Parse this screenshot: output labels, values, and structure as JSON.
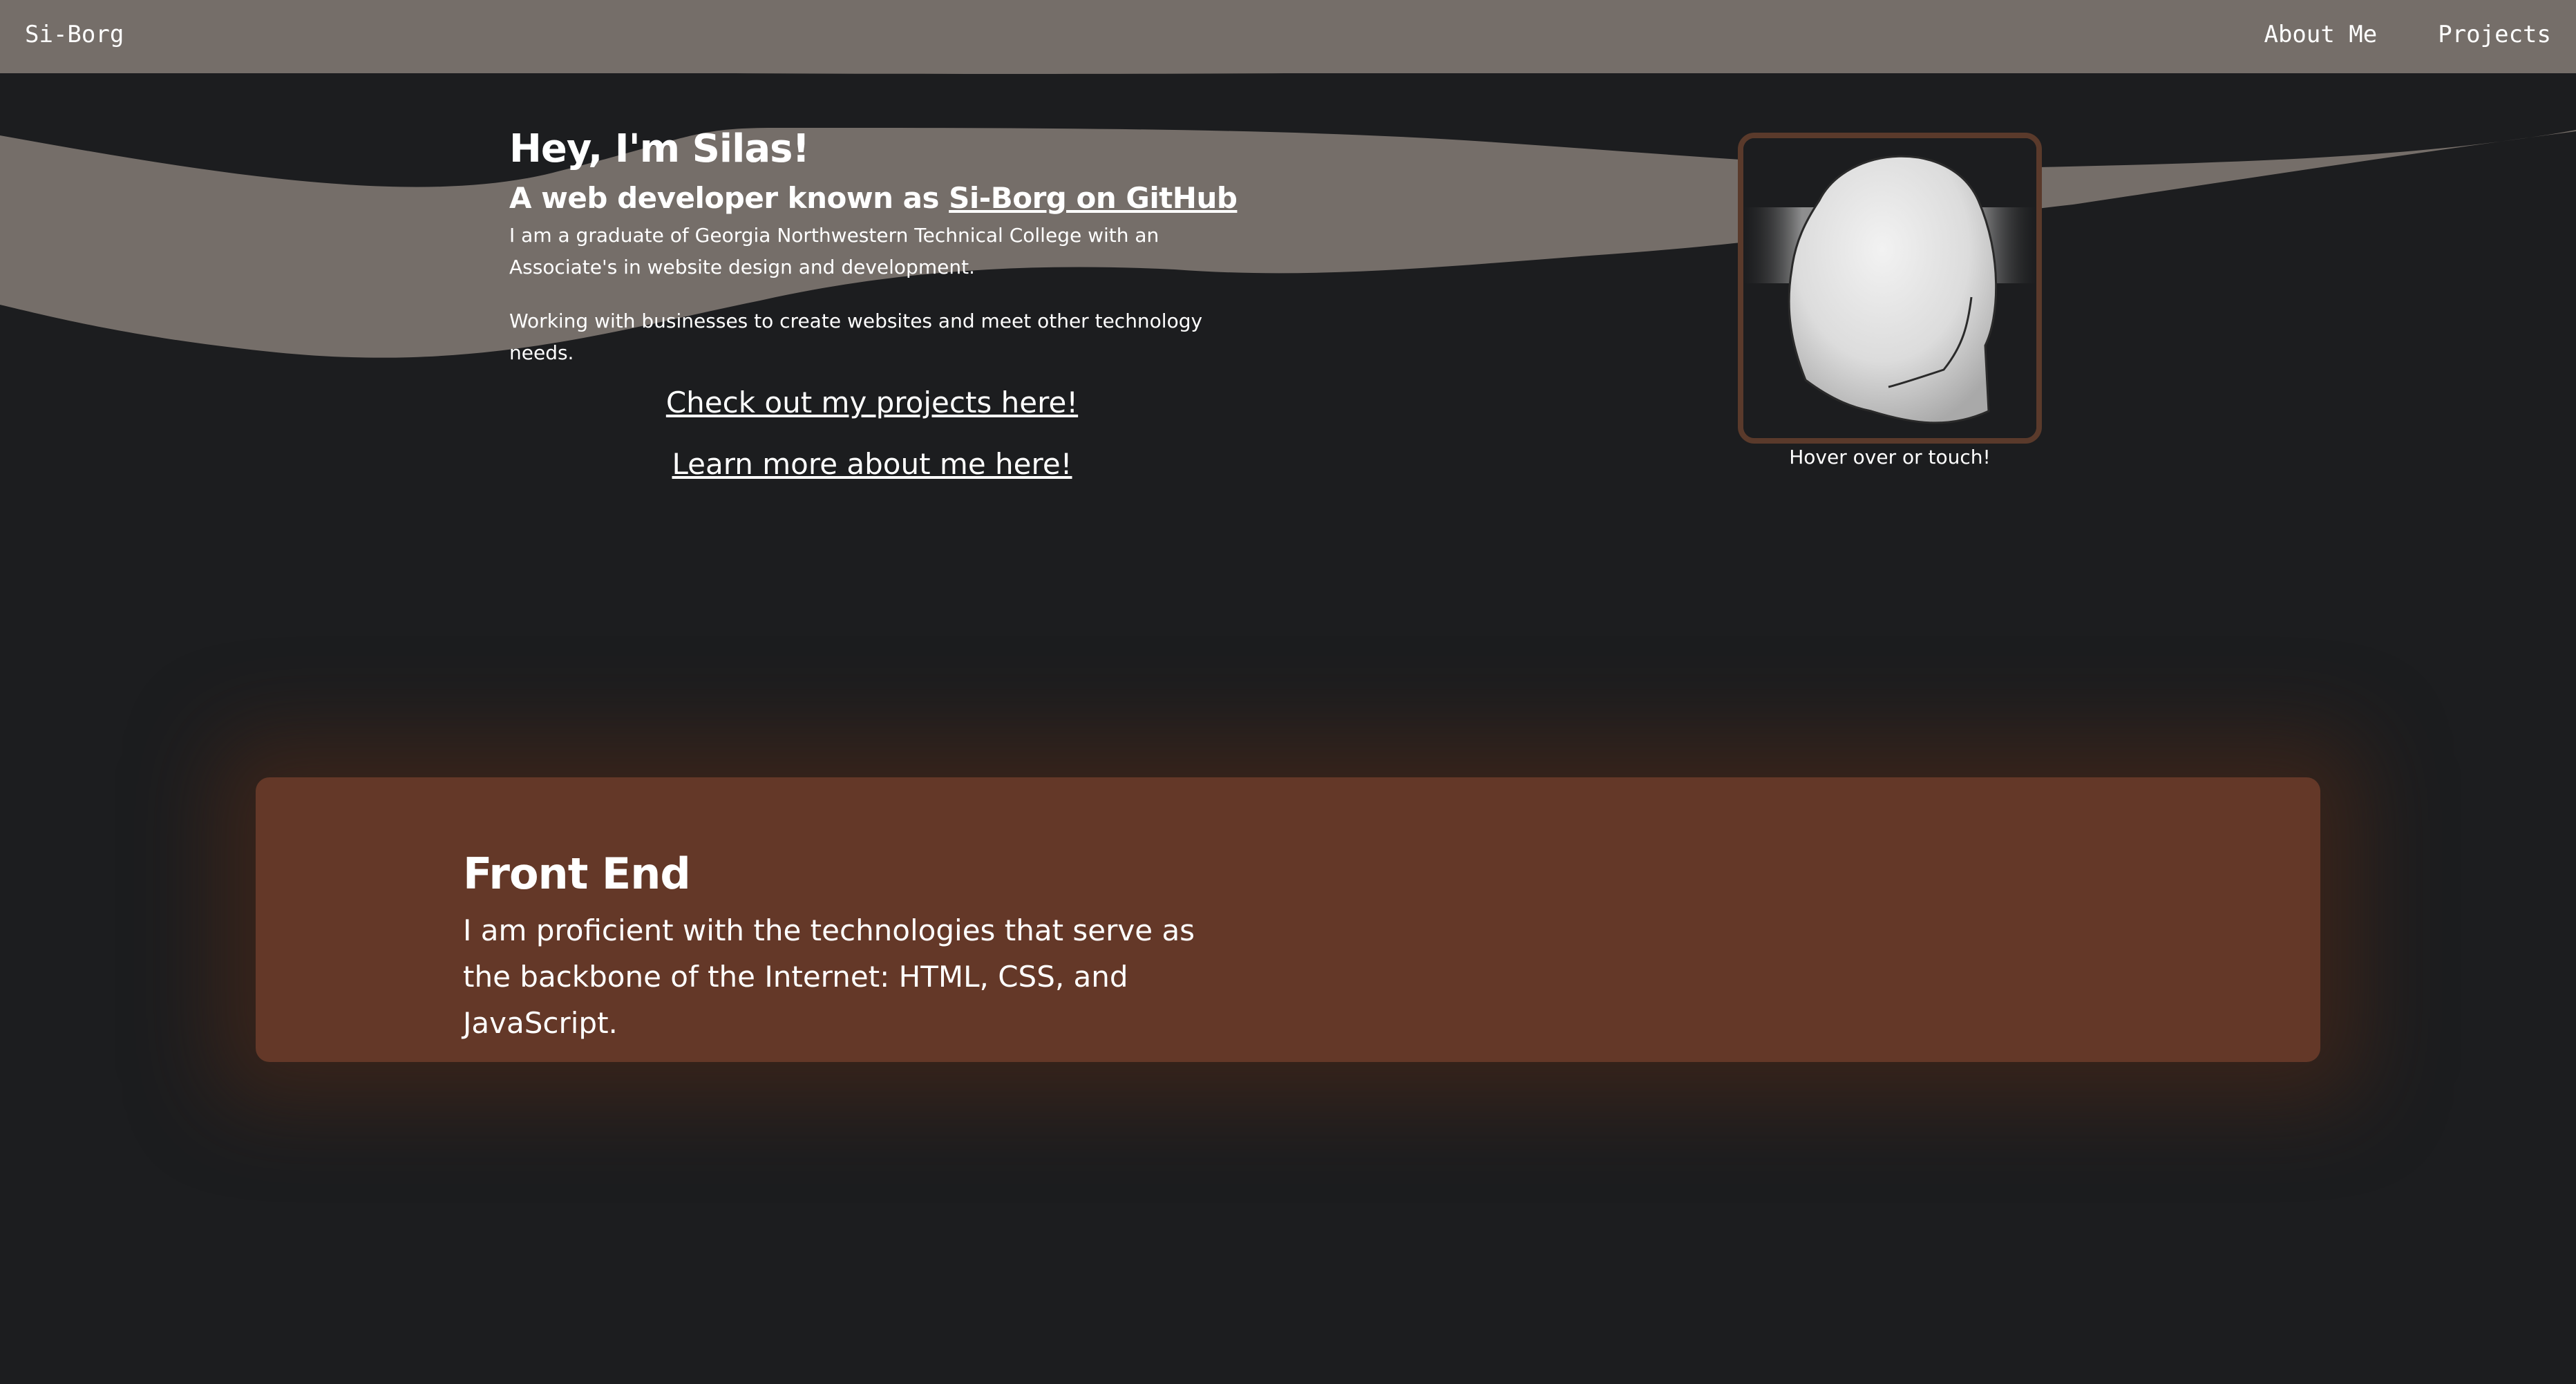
{
  "nav": {
    "brand": "Si-Borg",
    "links": [
      "About Me",
      "Projects"
    ]
  },
  "hero": {
    "title": "Hey, I'm Silas!",
    "subtitle_prefix": "A web developer known as ",
    "subtitle_link": "Si-Borg on GitHub",
    "paragraph1": "I am a graduate of Georgia Northwestern Technical College with an Associate's in website design and development.",
    "paragraph2": "Working with businesses to create websites and meet other technology needs.",
    "cta_projects": "Check out my projects here!",
    "cta_about": "Learn more about me here!"
  },
  "avatar": {
    "caption": "Hover over or touch!",
    "icon": "head-model-icon"
  },
  "skills": {
    "title": "Front End",
    "description": "I am proficient with the technologies that serve as the backbone of the Internet: HTML, CSS, and JavaScript."
  },
  "colors": {
    "background": "#1c1d1f",
    "navbar": "#756e69",
    "wave": "#756e69",
    "card": "#643828",
    "frame": "#5a3a2b",
    "text": "#ffffff"
  }
}
